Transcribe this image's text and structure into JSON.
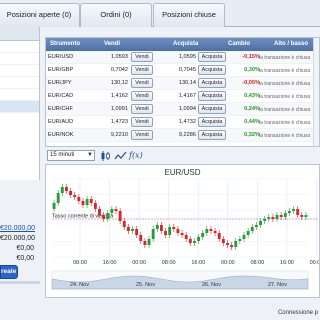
{
  "tabs": [
    {
      "label": "Posizioni aperte (0)"
    },
    {
      "label": "Ordini (0)"
    },
    {
      "label": "Posizioni chiuse"
    }
  ],
  "table": {
    "headers": {
      "instrument": "Strumento",
      "sell": "Vendi",
      "buy": "Acquista",
      "change": "Cambio",
      "highlow": "Alto / basso"
    },
    "sell_button": "Vendi",
    "buy_button": "Acquista",
    "rows": [
      {
        "symbol": "EUR/USD",
        "sell": "1,0593",
        "buy": "1,0595",
        "change": "-0,15%",
        "status": "la transazione è chiusa",
        "change_color": "neg"
      },
      {
        "symbol": "EUR/GBP",
        "sell": "0,7042",
        "buy": "0,7045",
        "change": "0,30%",
        "status": "la transazione è chiusa",
        "change_color": "pos"
      },
      {
        "symbol": "EUR/JPY",
        "sell": "130,12",
        "buy": "130,14",
        "change": "-0,05%",
        "status": "la transazione è chiusa",
        "change_color": "neg"
      },
      {
        "symbol": "EUR/CAD",
        "sell": "1,4162",
        "buy": "1,4167",
        "change": "0,43%",
        "status": "la transazione è chiusa",
        "change_color": "pos"
      },
      {
        "symbol": "EUR/CHF",
        "sell": "1,0991",
        "buy": "1,0994",
        "change": "0,24%",
        "status": "la transazione è chiusa",
        "change_color": "pos"
      },
      {
        "symbol": "EUR/AUD",
        "sell": "1,4723",
        "buy": "1,4732",
        "change": "0,44%",
        "status": "la transazione è chiusa",
        "change_color": "pos"
      },
      {
        "symbol": "EUR/NOK",
        "sell": "9,2210",
        "buy": "9,2286",
        "change": "0,32%",
        "status": "la transazione è chiusa",
        "change_color": "pos"
      }
    ]
  },
  "toolbar": {
    "interval": "15 minuti",
    "icons": [
      "candlestick-icon",
      "line-icon",
      "function-icon"
    ]
  },
  "chart_data": {
    "type": "candlestick",
    "title": "EUR/USD",
    "annotation": "Tasso corrente di vendita",
    "time_labels": [
      "08:00",
      "16:00",
      "00:00",
      "08:00",
      "16:00",
      "00:00",
      "08:00",
      "16:00",
      "00:00"
    ],
    "date_labels": [
      "24. Nov",
      "25. Nov",
      "26. Nov",
      "27. Nov"
    ],
    "price_labels": [],
    "grid": true
  },
  "account": {
    "link_value": "€20.000,00",
    "values": [
      "€20.000,00",
      "€0,00",
      "€0,00"
    ],
    "button_label": "reale"
  },
  "footer": {
    "connection": "Connessione p"
  },
  "colors": {
    "bull": "#2a9b3a",
    "bear": "#d62828",
    "header": "#5a7db0",
    "accent": "#2c64c8"
  }
}
